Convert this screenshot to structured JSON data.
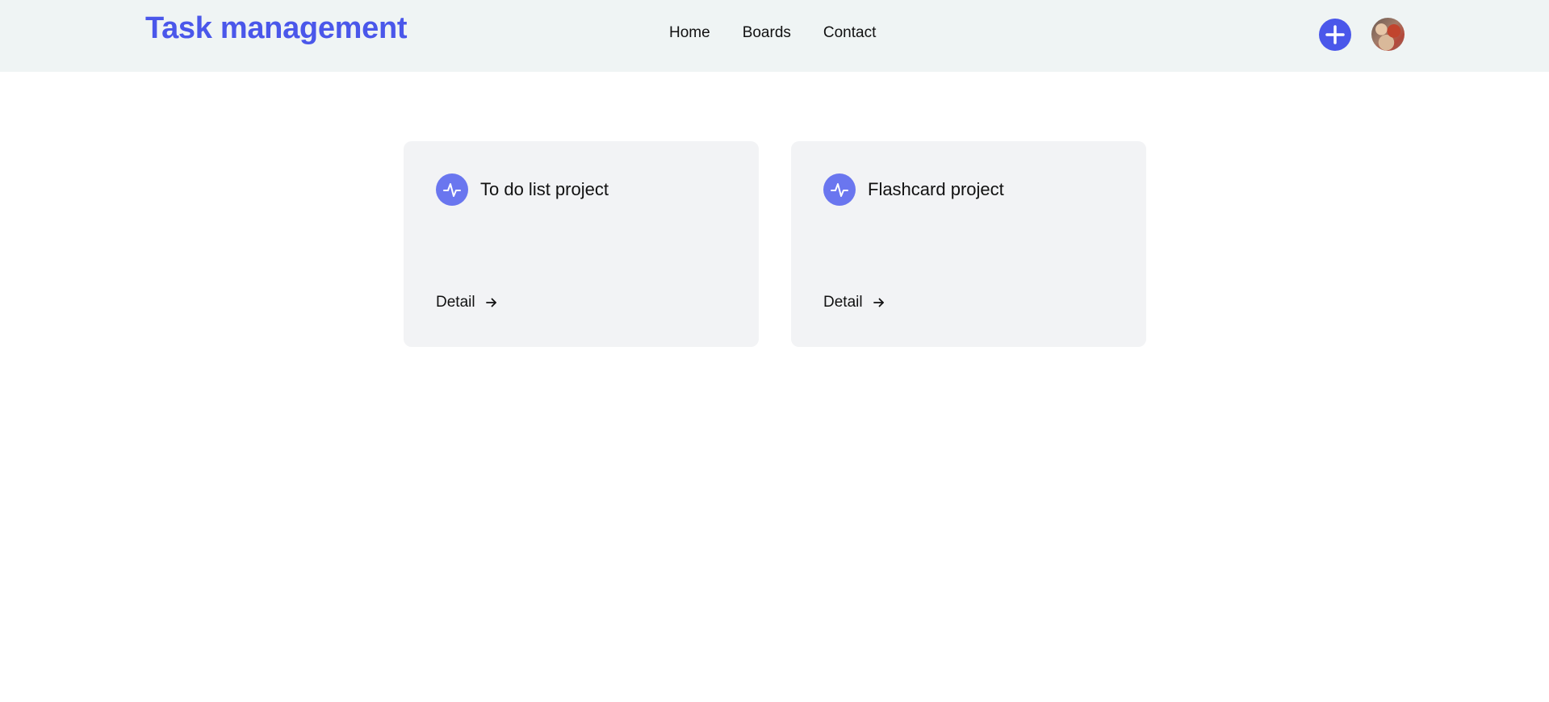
{
  "header": {
    "brand": "Task management",
    "nav": [
      {
        "label": "Home"
      },
      {
        "label": "Boards"
      },
      {
        "label": "Contact"
      }
    ],
    "add_icon": "plus-icon",
    "avatar_icon": "user-avatar"
  },
  "projects": [
    {
      "title": "To do list project",
      "icon": "activity-icon",
      "link_label": "Detail",
      "link_icon": "arrow-right-icon"
    },
    {
      "title": "Flashcard project",
      "icon": "activity-icon",
      "link_label": "Detail",
      "link_icon": "arrow-right-icon"
    }
  ],
  "colors": {
    "accent": "#4a57ea",
    "icon_bg": "#6a76ef",
    "header_bg": "#eff4f4",
    "card_bg": "#f2f3f5"
  }
}
